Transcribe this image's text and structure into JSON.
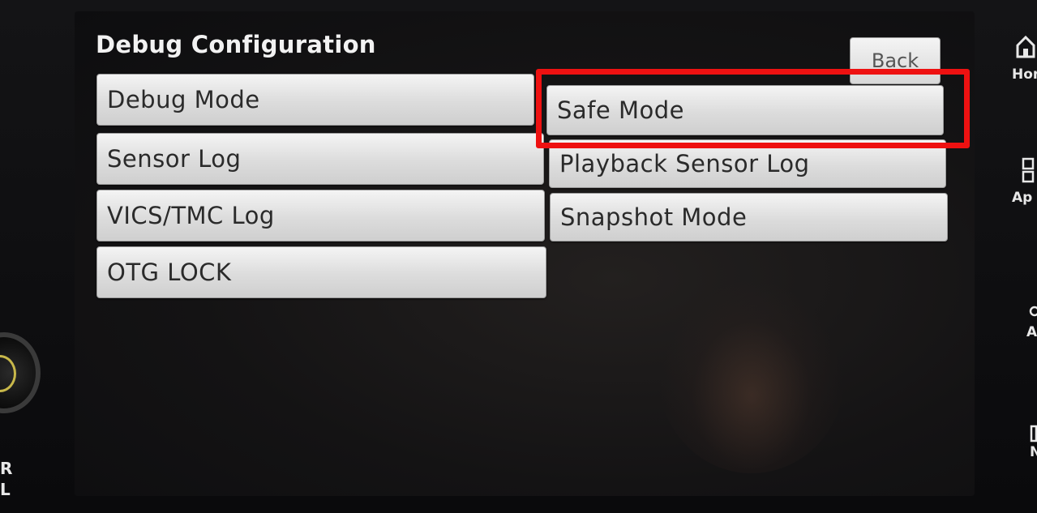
{
  "screen": {
    "title": "Debug Configuration",
    "back_label": "Back",
    "left_column": [
      {
        "label": "Debug Mode"
      },
      {
        "label": "Sensor Log"
      },
      {
        "label": "VICS/TMC Log"
      },
      {
        "label": "OTG LOCK"
      }
    ],
    "right_column": [
      {
        "label": "Safe Mode"
      },
      {
        "label": "Playback Sensor Log"
      },
      {
        "label": "Snapshot Mode"
      }
    ]
  },
  "side_panel": {
    "home_label": "Hon",
    "apps_label": "Ap",
    "third_label": "A",
    "fourth_label": "N"
  },
  "left_panel": {
    "label_line1": "R",
    "label_line2": "L"
  },
  "annotation": {
    "highlight_color": "#ee1111",
    "highlighted_item": "Safe Mode"
  }
}
